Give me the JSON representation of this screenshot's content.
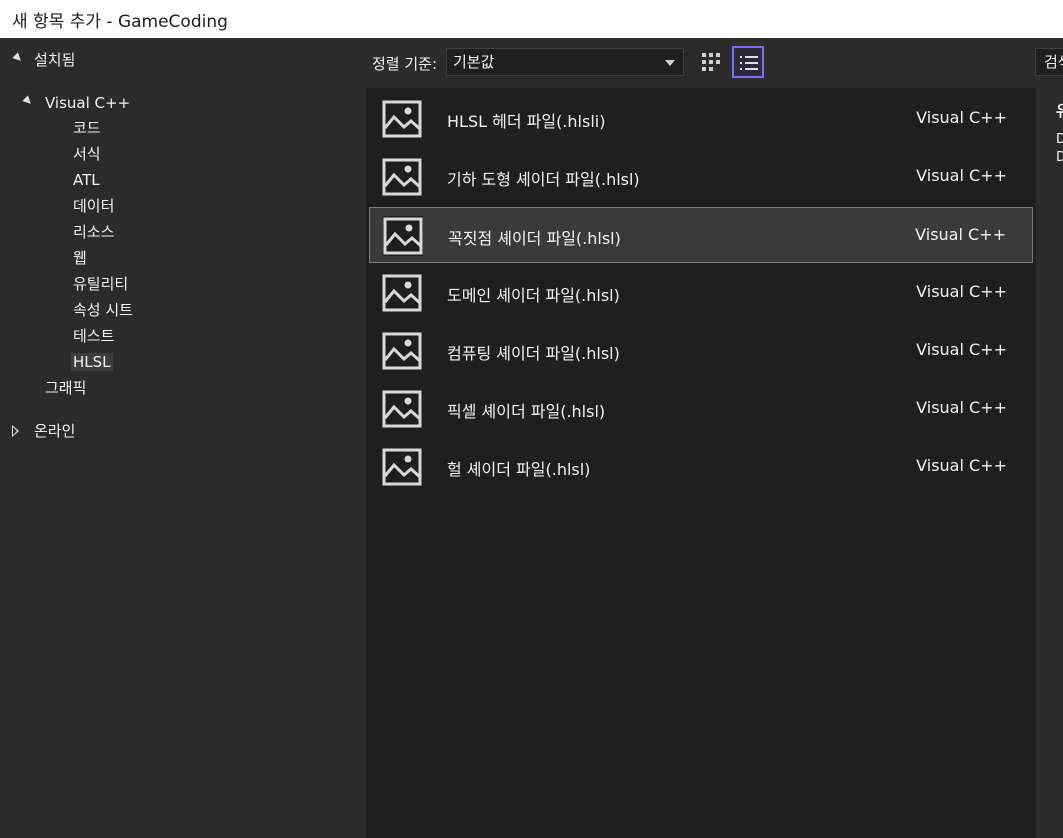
{
  "window": {
    "title": "새 항목 추가 - GameCoding"
  },
  "tree": {
    "installed_label": "설치됨",
    "visual_cpp_label": "Visual C++",
    "children": [
      "코드",
      "서식",
      "ATL",
      "데이터",
      "리소스",
      "웹",
      "유틸리티",
      "속성 시트",
      "테스트",
      "HLSL"
    ],
    "selected": "HLSL",
    "graphics_label": "그래픽",
    "online_label": "온라인"
  },
  "toolbar": {
    "sort_label": "정렬 기준:",
    "sort_value": "기본값",
    "search_placeholder": "검색"
  },
  "items": [
    {
      "name": "HLSL 헤더 파일(.hlsli)",
      "lang": "Visual C++"
    },
    {
      "name": "기하 도형 셰이더 파일(.hlsl)",
      "lang": "Visual C++"
    },
    {
      "name": "꼭짓점 셰이더 파일(.hlsl)",
      "lang": "Visual C++"
    },
    {
      "name": "도메인 셰이더 파일(.hlsl)",
      "lang": "Visual C++"
    },
    {
      "name": "컴퓨팅 셰이더 파일(.hlsl)",
      "lang": "Visual C++"
    },
    {
      "name": "픽셀 셰이더 파일(.hlsl)",
      "lang": "Visual C++"
    },
    {
      "name": "헐 셰이더 파일(.hlsl)",
      "lang": "Visual C++"
    }
  ],
  "selected_item_index": 2,
  "details": {
    "type_label": "유",
    "line1": "D",
    "line2": "D"
  },
  "colors": {
    "accent": "#7a6cff",
    "panel": "#2b2b2b",
    "list_bg": "#1f1f1f",
    "selected_row": "#3a3a3a"
  },
  "icons": {
    "installed_caret": "caret-down-icon",
    "online_caret": "caret-right-icon",
    "item": "image-icon",
    "grid_view": "grid-view-icon",
    "list_view": "list-view-icon",
    "dropdown": "chevron-down-icon"
  }
}
